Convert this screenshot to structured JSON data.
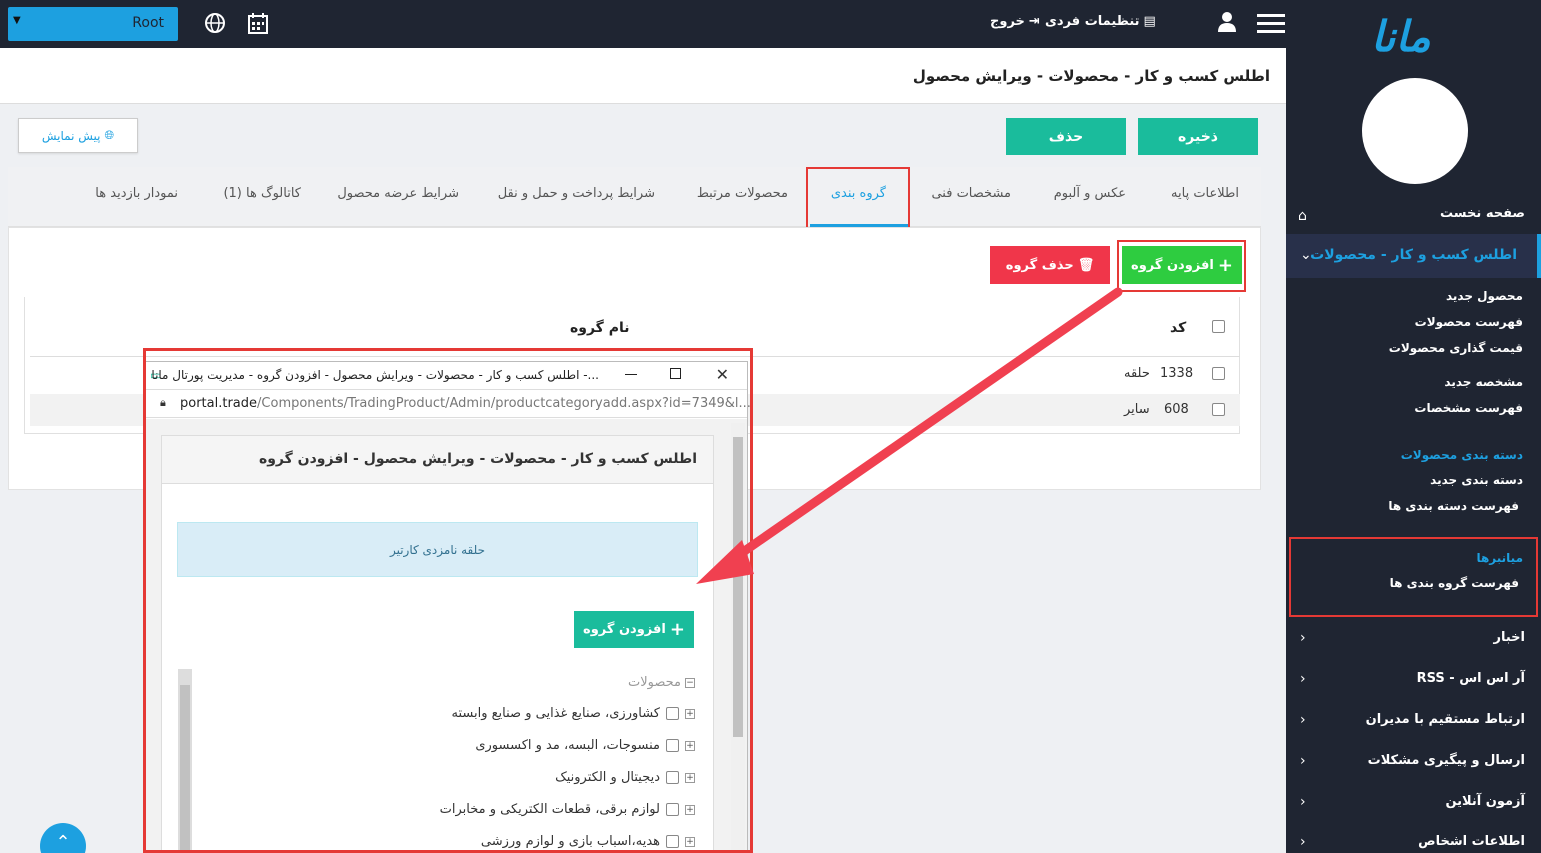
{
  "topbar": {
    "root_value": "Root",
    "logout_label": "خروج",
    "settings_label": "تنظیمات فردی"
  },
  "sidebar": {
    "logo": "مانا",
    "home": "صفحه نخست",
    "active_section": "اطلس کسب و کار - محصولات",
    "sub_items": [
      "محصول جدید",
      "فهرست محصولات",
      "قیمت گذاری محصولات",
      "مشخصه جدید",
      "فهرست مشخصات"
    ],
    "category_group": "دسته بندی محصولات",
    "category_items": [
      "دسته بندی جدید",
      "فهرست دسته بندی ها"
    ],
    "distributors_group": "میانبرها",
    "distributors_item": "فهرست گروه بندی ها",
    "main_items": [
      "اخبار",
      "آر اس اس - RSS",
      "ارتباط مستقیم با مدیران",
      "ارسال و پیگیری مشکلات",
      "آزمون آنلاین",
      "اطلاعات اشخاص"
    ]
  },
  "page": {
    "title": "اطلس کسب و کار - محصولات - ویرایش محصول",
    "save_label": "ذخیره",
    "delete_label": "حذف",
    "preview_label": "پیش نمایش"
  },
  "tabs": [
    "اطلاعات پایه",
    "عکس و آلبوم",
    "مشخصات فنی",
    "گروه بندی",
    "محصولات مرتبط",
    "شرایط پرداخت و حمل و نقل",
    "شرایط عرضه محصول",
    "کاتالوگ ها (1)",
    "نمودار بازدید ها"
  ],
  "grouping": {
    "add_label": "افزودن گروه",
    "delete_label": "حذف گروه",
    "col_code": "کد",
    "col_name": "نام گروه",
    "rows": [
      {
        "code": "1338",
        "name": "حلقه"
      },
      {
        "code": "608",
        "name": "سایر"
      }
    ]
  },
  "popup": {
    "window_title": "اطلس کسب و کار - محصولات - ویرایش محصول - افزودن گروه - مدیریت پورتال مانا -...",
    "url_domain": "portal.trade",
    "url_path": "/Components/TradingProduct/Admin/productcategoryadd.aspx?id=7349&l...",
    "panel_title": "اطلس کسب و کار - محصولات - ویرایش محصول - افزودن گروه",
    "info_text": "حلقه نامزدی کارتیر",
    "add_label": "افزودن گروه",
    "tree_root": "محصولات",
    "tree_items": [
      "کشاورزی، صنایع غذایی و صنایع وابسته",
      "منسوجات، البسه، مد و اکسسوری",
      "دیجیتال و الکترونیک",
      "لوازم برقی، قطعات الکتریکی و مخابرات",
      "هدیه،اسباب بازی و لوازم ورزشی"
    ]
  },
  "colors": {
    "accent": "#1da0e0",
    "teal": "#1abc9c",
    "green": "#2ecc40",
    "red": "#f0364a",
    "highlight": "#e53935",
    "dark": "#1f2532"
  }
}
